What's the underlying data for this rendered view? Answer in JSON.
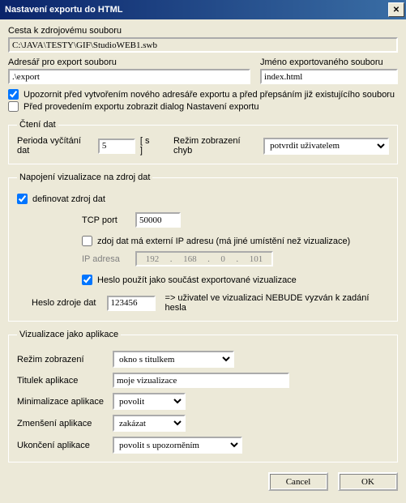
{
  "title": "Nastavení exportu do HTML",
  "path_label": "Cesta k zdrojovému souboru",
  "path_value": "C:\\JAVA\\TESTY\\GIF\\StudioWEB1.swb",
  "dir_label": "Adresář pro export souboru",
  "dir_value": ".\\export",
  "file_label": "Jméno exportovaného souboru",
  "file_value": "index.html",
  "warn_label": "Upozornit před vytvořením nového adresáře exportu a před přepsáním již existujícího souboru",
  "warn_checked": true,
  "presettings_label": "Před provedením exportu zobrazit dialog Nastavení exportu",
  "presettings_checked": false,
  "reading": {
    "legend": "Čtení dat",
    "period_label": "Perioda vyčítání dat",
    "period_value": "5",
    "period_unit": "[ s ]",
    "err_label": "Režim zobrazení chyb",
    "err_value": "potvrdit uživatelem"
  },
  "conn": {
    "legend": "Napojení vizualizace na zdroj dat",
    "define_label": "definovat zdroj dat",
    "define_checked": true,
    "tcp_label": "TCP port",
    "tcp_value": "50000",
    "ext_label": "zdoj dat má externí IP adresu (má jiné umístění než vizualizace)",
    "ext_checked": false,
    "ip_label": "IP adresa",
    "ip": [
      "192",
      "168",
      "0",
      "101"
    ],
    "pwd_part_label": "Heslo použít jako součást exportované vizualizace",
    "pwd_part_checked": true,
    "pwd_label": "Heslo zdroje dat",
    "pwd_value": "123456",
    "pwd_note": "=> uživatel ve vizualizaci NEBUDE vyzván k zadání hesla"
  },
  "app": {
    "legend": "Vizualizace jako aplikace",
    "mode_label": "Režim zobrazení",
    "mode_value": "okno s titulkem",
    "title_label": "Titulek aplikace",
    "title_value": "moje vizualizace",
    "min_label": "Minimalizace aplikace",
    "min_value": "povolit",
    "resize_label": "Zmenšení aplikace",
    "resize_value": "zakázat",
    "close_label": "Ukončení aplikace",
    "close_value": "povolit s upozorněním"
  },
  "buttons": {
    "cancel": "Cancel",
    "ok": "OK"
  }
}
